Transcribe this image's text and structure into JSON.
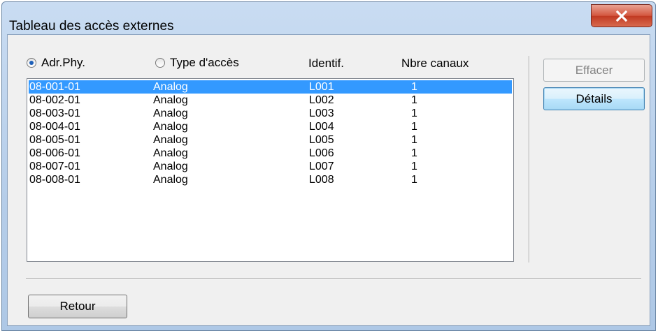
{
  "window": {
    "title": "Tableau des accès externes"
  },
  "sort_options": [
    {
      "label": "Adr.Phy.",
      "checked": true
    },
    {
      "label": "Type d'accès",
      "checked": false
    }
  ],
  "columns": {
    "identif": "Identif.",
    "nbre_canaux": "Nbre canaux"
  },
  "rows": [
    {
      "adr": "08-001-01",
      "type": "Analog",
      "id": "L001",
      "canaux": "1",
      "selected": true
    },
    {
      "adr": "08-002-01",
      "type": "Analog",
      "id": "L002",
      "canaux": "1"
    },
    {
      "adr": "08-003-01",
      "type": "Analog",
      "id": "L003",
      "canaux": "1"
    },
    {
      "adr": "08-004-01",
      "type": "Analog",
      "id": "L004",
      "canaux": "1"
    },
    {
      "adr": "08-005-01",
      "type": "Analog",
      "id": "L005",
      "canaux": "1"
    },
    {
      "adr": "08-006-01",
      "type": "Analog",
      "id": "L006",
      "canaux": "1"
    },
    {
      "adr": "08-007-01",
      "type": "Analog",
      "id": "L007",
      "canaux": "1"
    },
    {
      "adr": "08-008-01",
      "type": "Analog",
      "id": "L008",
      "canaux": "1"
    }
  ],
  "buttons": {
    "effacer": "Effacer",
    "details": "Détails",
    "retour": "Retour"
  },
  "icons": {
    "close": "close-icon"
  },
  "colors": {
    "selection": "#3399ff",
    "close_button": "#c94a34"
  }
}
